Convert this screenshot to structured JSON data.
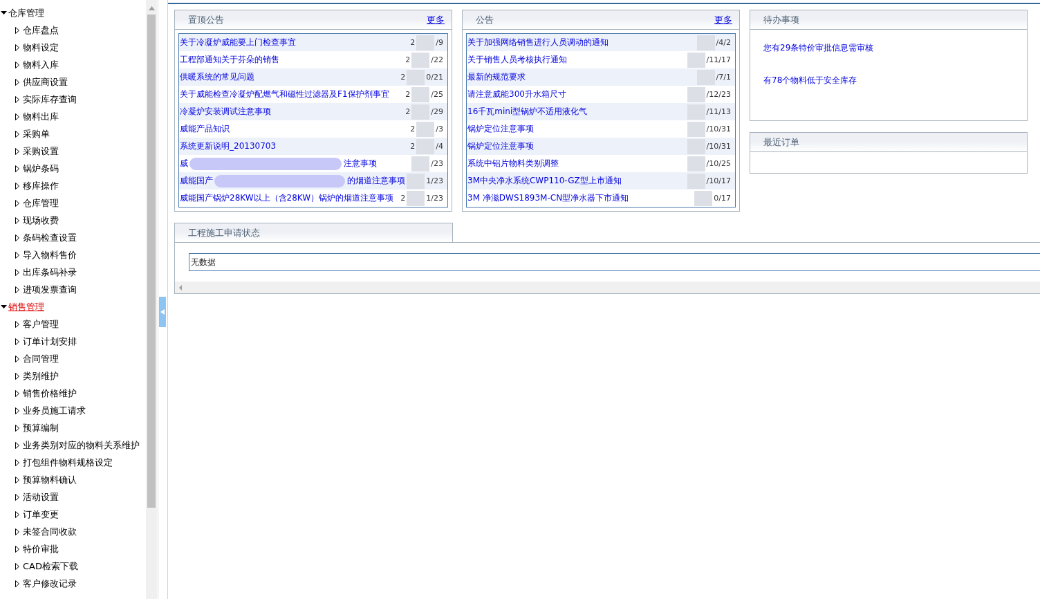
{
  "sidebar": {
    "groups": [
      {
        "label": "仓库管理",
        "expanded": true,
        "selected": false,
        "children": [
          "仓库盘点",
          "物料设定",
          "物料入库",
          "供应商设置",
          "实际库存查询",
          "物料出库",
          "采购单",
          "采购设置",
          "锅炉条码",
          "移库操作",
          "仓库管理",
          "现场收费",
          "条码检查设置",
          "导入物料售价",
          "出库条码补录",
          "进项发票查询"
        ]
      },
      {
        "label": "销售管理",
        "expanded": true,
        "selected": true,
        "children": [
          "客户管理",
          "订单计划安排",
          "合同管理",
          "类别维护",
          "销售价格维护",
          "业务员施工请求",
          "预算编制",
          "业务类别对应的物料关系维护",
          "打包组件物料规格设定",
          "预算物料确认",
          "活动设置",
          "订单变更",
          "未签合同收款",
          "特价审批",
          "CAD检索下载",
          "客户修改记录"
        ]
      }
    ]
  },
  "notice_panels": [
    {
      "title": "置顶公告",
      "more": "更多",
      "rows": [
        {
          "title": "关于冷凝炉威能要上门检查事宜",
          "date_head": "2",
          "date_tail": "/9"
        },
        {
          "title": "工程部通知关于芬朵的销售",
          "date_head": "2",
          "date_tail": "/22"
        },
        {
          "title": "供暖系统的常见问题",
          "date_head": "2",
          "date_tail": "0/21"
        },
        {
          "title": "关于威能检查冷凝炉配燃气和磁性过滤器及F1保护剂事宜",
          "date_head": "2",
          "date_tail": "/25"
        },
        {
          "title": "冷凝炉安装调试注意事项",
          "date_head": "2",
          "date_tail": "/29"
        },
        {
          "title": "威能产品知识",
          "date_head": "2",
          "date_tail": "/3"
        },
        {
          "title": "系统更新说明_20130703",
          "date_head": "2",
          "date_tail": "/4"
        },
        {
          "title": "威",
          "title_tail": "注意事项",
          "date_tail": "/23"
        },
        {
          "title": "威能国产",
          "title_tail": "的烟道注意事项",
          "date_tail": "1/23"
        },
        {
          "title": "威能国产锅炉28KW以上（含28KW）锅炉的烟道注意事项",
          "date_head": "2",
          "date_tail": "1/23"
        }
      ]
    },
    {
      "title": "公告",
      "more": "更多",
      "rows": [
        {
          "title": "关于加强网络销售进行人员调动的通知",
          "date_tail": "/4/2"
        },
        {
          "title": "关于销售人员考核执行通知",
          "date_tail": "/11/17"
        },
        {
          "title": "最新的规范要求",
          "date_tail": "/7/1"
        },
        {
          "title": "请注意威能300升水箱尺寸",
          "date_tail": "/12/23"
        },
        {
          "title": "16千瓦mini型锅炉不适用液化气",
          "date_tail": "/11/13"
        },
        {
          "title": "锅炉定位注意事项",
          "date_tail": "/10/31"
        },
        {
          "title": "锅炉定位注意事项",
          "date_tail": "/10/31"
        },
        {
          "title": "系统中铝片物料类别调整",
          "date_tail": "/10/25"
        },
        {
          "title": "3M中央净水系统CWP110-GZ型上市通知",
          "date_tail": "/10/17"
        },
        {
          "title": "3M 净滋DWS1893M-CN型净水器下市通知",
          "date_tail": "0/17"
        }
      ]
    }
  ],
  "todo_panel": {
    "title": "待办事项",
    "items": [
      "您有29条特价审批信息需审核",
      "有78个物料低于安全库存"
    ]
  },
  "recent_orders_panel": {
    "title": "最近订单"
  },
  "project_status_panel": {
    "title": "工程施工申请状态",
    "value": "无数据"
  }
}
